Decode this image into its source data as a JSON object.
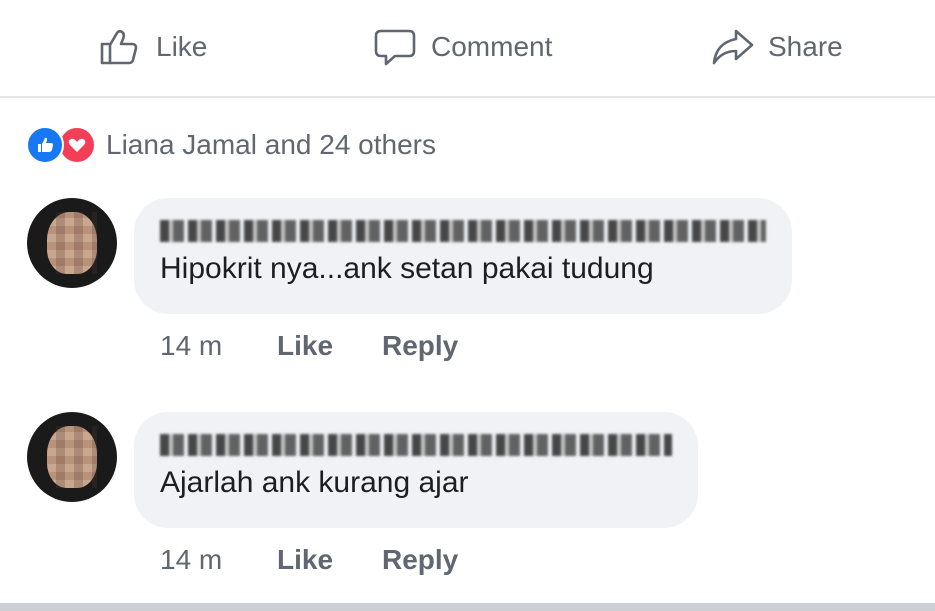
{
  "actions": {
    "like_label": "Like",
    "comment_label": "Comment",
    "share_label": "Share",
    "like_icon": "thumbs-up-icon",
    "comment_icon": "speech-bubble-icon",
    "share_icon": "share-arrow-icon"
  },
  "reactions": {
    "summary": "Liana Jamal and 24 others",
    "icons": [
      "like-reaction-icon",
      "love-reaction-icon"
    ],
    "like_color": "#1877f2",
    "love_color": "#f33e58"
  },
  "comments": [
    {
      "author": "(name obscured)",
      "text": "Hipokrit nya...ank setan pakai tudung",
      "time": "14 m",
      "like_label": "Like",
      "reply_label": "Reply"
    },
    {
      "author": "(name obscured)",
      "text": "Ajarlah ank kurang ajar",
      "time": "14 m",
      "like_label": "Like",
      "reply_label": "Reply"
    }
  ]
}
